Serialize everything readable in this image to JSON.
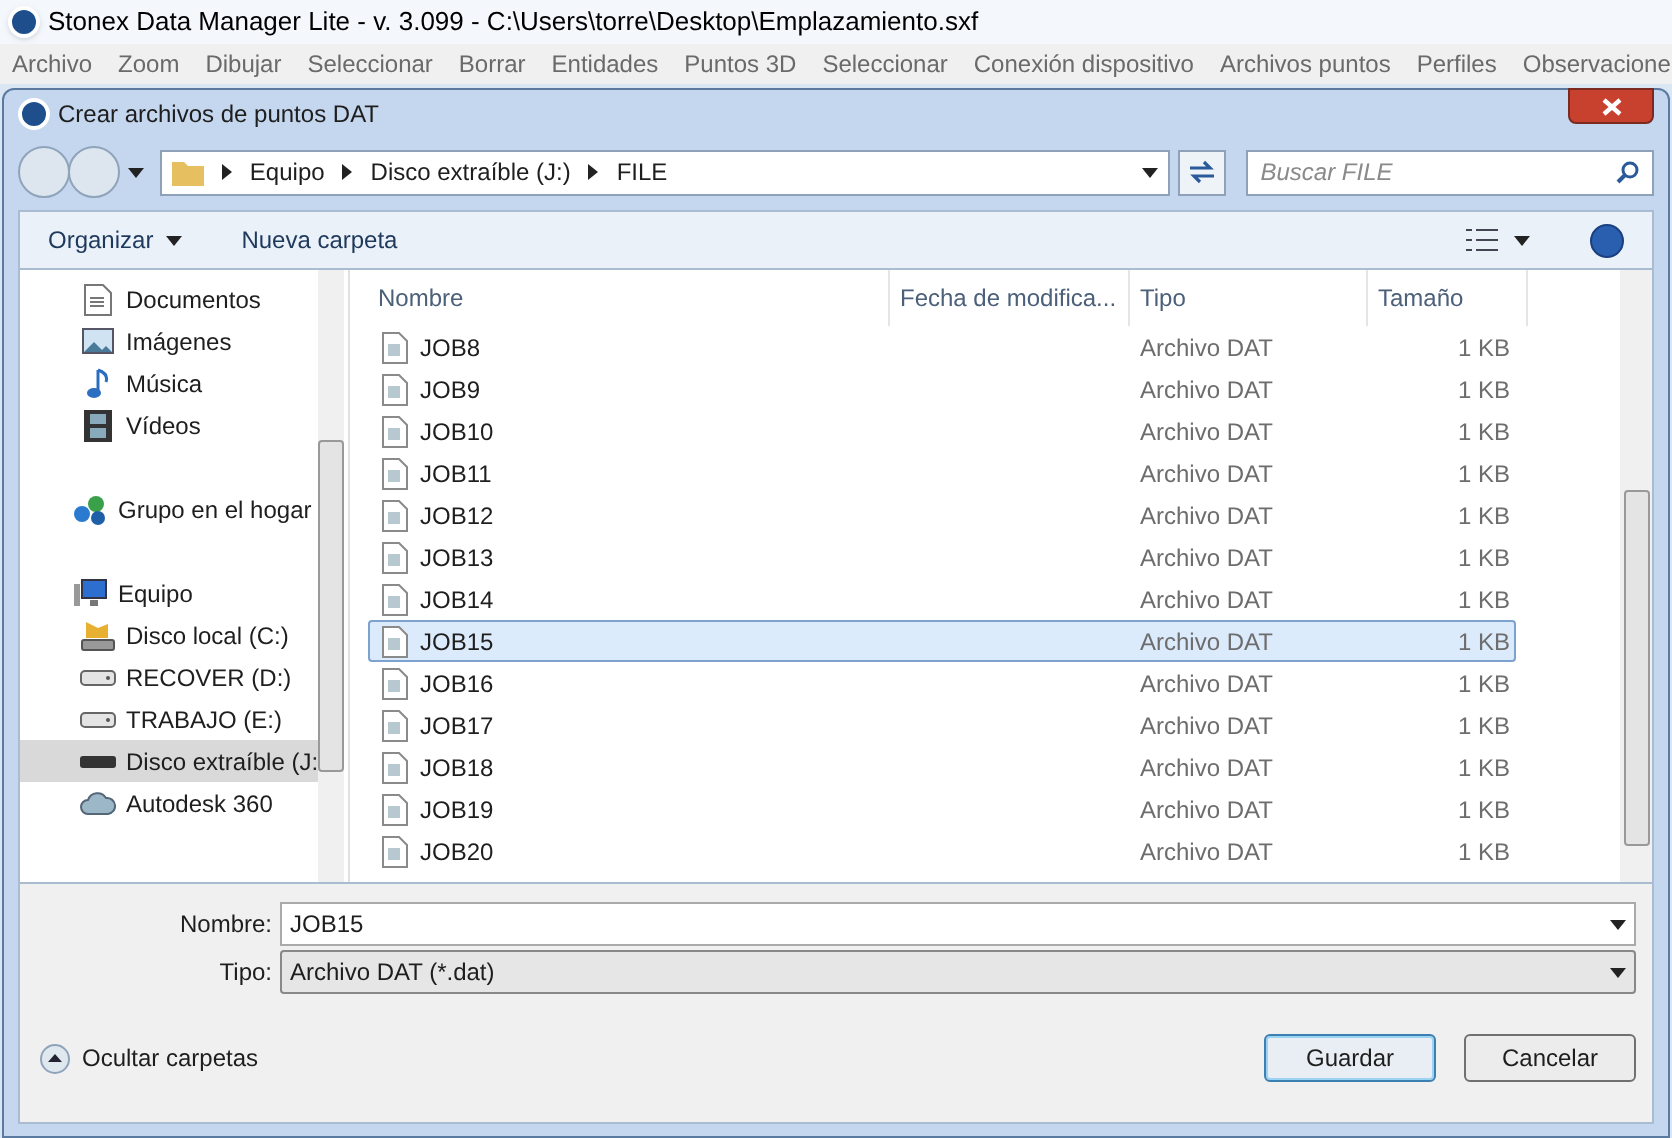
{
  "app": {
    "title": "Stonex Data Manager Lite - v. 3.099 - C:\\Users\\torre\\Desktop\\Emplazamiento.sxf",
    "menu": [
      "Archivo",
      "Zoom",
      "Dibujar",
      "Seleccionar",
      "Borrar",
      "Entidades",
      "Puntos 3D",
      "Seleccionar",
      "Conexión dispositivo",
      "Archivos puntos",
      "Perfiles",
      "Observacione"
    ]
  },
  "dialog": {
    "title": "Crear archivos de puntos DAT",
    "breadcrumb": [
      "Equipo",
      "Disco extraíble (J:)",
      "FILE"
    ],
    "search": {
      "placeholder": "Buscar FILE"
    },
    "toolbar": [
      "Organizar",
      "Nueva carpeta"
    ],
    "sidebar": {
      "items": [
        {
          "label": "Documentos",
          "kind": "docs",
          "selected": false
        },
        {
          "label": "Imágenes",
          "kind": "pictures",
          "selected": false
        },
        {
          "label": "Música",
          "kind": "music",
          "selected": false
        },
        {
          "label": "Vídeos",
          "kind": "videos",
          "selected": false
        },
        {
          "label": "Grupo en el hogar",
          "kind": "homegroup",
          "selected": false
        },
        {
          "label": "Equipo",
          "kind": "computer",
          "selected": false
        },
        {
          "label": "Disco local (C:)",
          "kind": "system-drive",
          "selected": false
        },
        {
          "label": "RECOVER (D:)",
          "kind": "drive",
          "selected": false
        },
        {
          "label": "TRABAJO (E:)",
          "kind": "drive",
          "selected": false
        },
        {
          "label": "Disco extraíble (J:",
          "kind": "removable",
          "selected": true
        },
        {
          "label": "Autodesk 360",
          "kind": "cloud",
          "selected": false
        }
      ]
    },
    "table": {
      "columns": [
        "Nombre",
        "Fecha de modifica...",
        "Tipo",
        "Tamaño"
      ],
      "rows": [
        {
          "name": "JOB8",
          "type": "Archivo DAT",
          "size": "1 KB",
          "selected": false
        },
        {
          "name": "JOB9",
          "type": "Archivo DAT",
          "size": "1 KB",
          "selected": false
        },
        {
          "name": "JOB10",
          "type": "Archivo DAT",
          "size": "1 KB",
          "selected": false
        },
        {
          "name": "JOB11",
          "type": "Archivo DAT",
          "size": "1 KB",
          "selected": false
        },
        {
          "name": "JOB12",
          "type": "Archivo DAT",
          "size": "1 KB",
          "selected": false
        },
        {
          "name": "JOB13",
          "type": "Archivo DAT",
          "size": "1 KB",
          "selected": false
        },
        {
          "name": "JOB14",
          "type": "Archivo DAT",
          "size": "1 KB",
          "selected": false
        },
        {
          "name": "JOB15",
          "type": "Archivo DAT",
          "size": "1 KB",
          "selected": true
        },
        {
          "name": "JOB16",
          "type": "Archivo DAT",
          "size": "1 KB",
          "selected": false
        },
        {
          "name": "JOB17",
          "type": "Archivo DAT",
          "size": "1 KB",
          "selected": false
        },
        {
          "name": "JOB18",
          "type": "Archivo DAT",
          "size": "1 KB",
          "selected": false
        },
        {
          "name": "JOB19",
          "type": "Archivo DAT",
          "size": "1 KB",
          "selected": false
        },
        {
          "name": "JOB20",
          "type": "Archivo DAT",
          "size": "1 KB",
          "selected": false
        }
      ]
    },
    "filename": {
      "label": "Nombre:",
      "value": "JOB15"
    },
    "filetype": {
      "label": "Tipo:",
      "value": "Archivo DAT (*.dat)"
    },
    "hide_folders": "Ocultar carpetas",
    "buttons": [
      "Guardar",
      "Cancelar"
    ]
  }
}
